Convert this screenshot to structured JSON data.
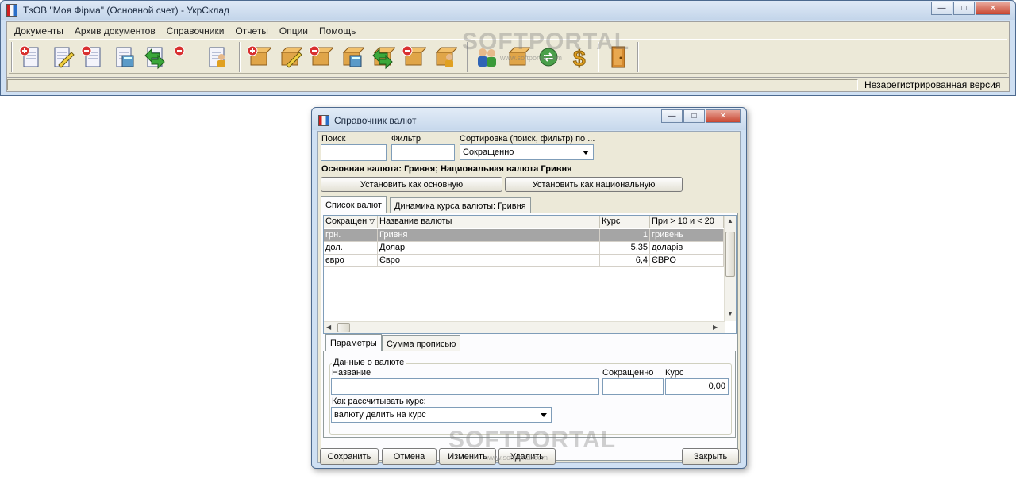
{
  "main_window": {
    "title": "ТзОВ \"Моя Фірма\" (Основной счет) - УкрСклад",
    "menu": [
      "Документы",
      "Архив документов",
      "Справочники",
      "Отчеты",
      "Опции",
      "Помощь"
    ],
    "status_text": "Незарегистрированная версия",
    "window_buttons": {
      "minimize": "—",
      "maximize": "□",
      "close": "✕"
    }
  },
  "toolbar": {
    "groups": [
      [
        "new-doc-icon",
        "edit-doc-icon",
        "delete-doc-icon",
        "calc-doc-icon",
        "transfer-doc-icon",
        "delete-list-icon",
        "user-doc-icon"
      ],
      [
        "new-box-icon",
        "edit-box-icon",
        "delete-box-icon",
        "calc-box-icon",
        "transfer-box-icon",
        "delete-box-list-icon",
        "user-box-icon"
      ],
      [
        "people-icon",
        "package-icon",
        "exchange-icon",
        "dollar-icon"
      ],
      [
        "exit-door-icon"
      ]
    ]
  },
  "watermark": {
    "text": "SOFTPORTAL",
    "sub": "www.softportal.com"
  },
  "dialog": {
    "title": "Справочник валют",
    "search_label": "Поиск",
    "search_value": "",
    "filter_label": "Фильтр",
    "filter_value": "",
    "sort_label": "Сортировка (поиск, фильтр) по ...",
    "sort_value": "Сокращенно",
    "base_currency_info": "Основная валюта: Гривня; Национальная валюта Гривня",
    "btn_set_base": "Установить как основную",
    "btn_set_national": "Установить как национальную",
    "tabs": [
      "Список валют",
      "Динамика курса валюты: Гривня"
    ],
    "grid": {
      "columns": [
        "Сокращен",
        "Название валюты",
        "Курс",
        "При > 10 и < 20"
      ],
      "rows": [
        [
          "грн.",
          "Гривня",
          "1",
          "гривень"
        ],
        [
          "дол.",
          "Долар",
          "5,35",
          "доларів"
        ],
        [
          "євро",
          "Євро",
          "6,4",
          "ЄВРО"
        ]
      ],
      "selected_row": 0
    },
    "bottom_tabs": [
      "Параметры",
      "Сумма прописью"
    ],
    "group_title": "Данные о валюте",
    "name_label": "Название",
    "name_value": "",
    "short_label": "Сокращенно",
    "short_value": "",
    "rate_label": "Курс",
    "rate_value": "0,00",
    "calc_label": "Как рассчитывать курс:",
    "calc_value": "валюту делить на курс",
    "btn_save": "Сохранить",
    "btn_cancel": "Отмена",
    "btn_edit": "Изменить",
    "btn_delete": "Удалить",
    "btn_close": "Закрыть"
  }
}
